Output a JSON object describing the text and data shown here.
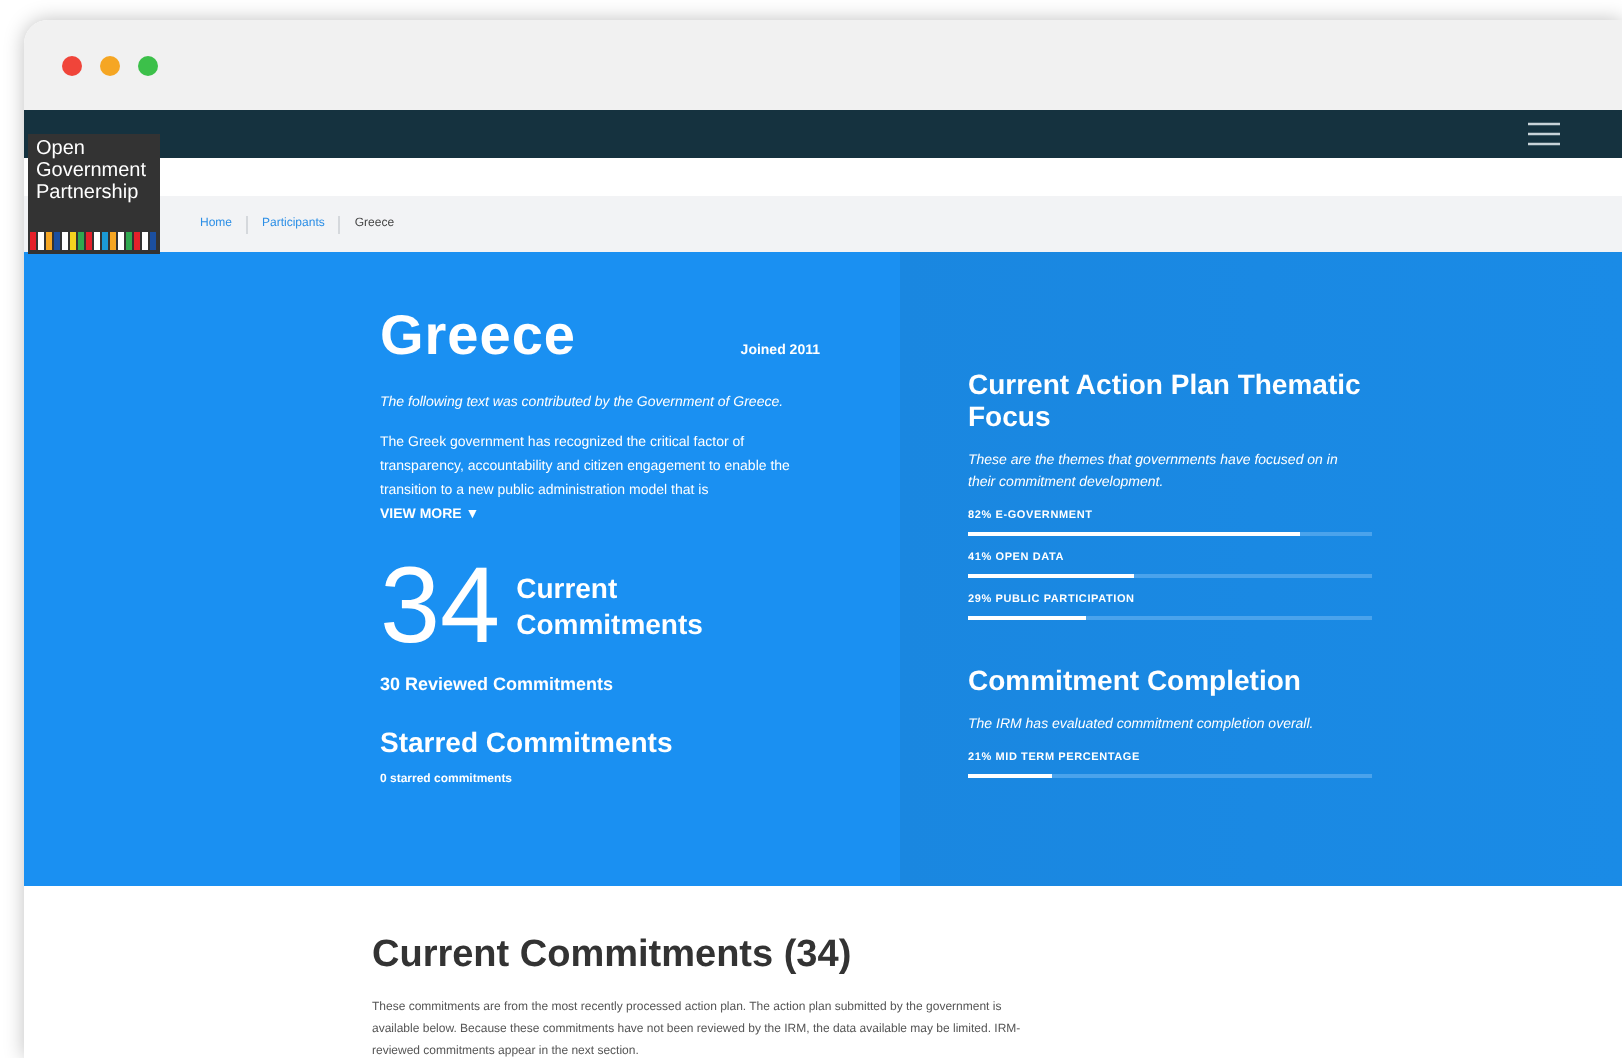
{
  "logo": {
    "lines": [
      "Open",
      "Government",
      "Partnership"
    ]
  },
  "breadcrumb": [
    {
      "label": "Home",
      "current": false
    },
    {
      "label": "Participants",
      "current": false
    },
    {
      "label": "Greece",
      "current": true
    }
  ],
  "country": {
    "name": "Greece",
    "joined": "Joined 2011",
    "intro": "The following text was contributed by the Government of Greece.",
    "body": "The Greek government has recognized the critical factor of transparency, accountability and citizen engagement to enable the transition to a new public administration model that is",
    "view_more": "VIEW MORE",
    "view_more_icon": "▼"
  },
  "commitments": {
    "count": "34",
    "label": "Current Commitments",
    "reviewed": "30 Reviewed Commitments",
    "starred_title": "Starred Commitments",
    "starred": "0 starred commitments"
  },
  "thematic": {
    "title": "Current Action Plan Thematic Focus",
    "subtitle": "These are the themes that governments have focused on in their commitment development.",
    "themes": [
      {
        "label": "82% E-GOVERNMENT",
        "level": 0.82
      },
      {
        "label": "41% OPEN DATA",
        "level": 0.41
      },
      {
        "label": "29% PUBLIC PARTICIPATION",
        "level": 0.29
      }
    ]
  },
  "completion": {
    "title": "Commitment Completion",
    "subtitle": "The IRM has evaluated commitment completion overall.",
    "items": [
      {
        "label": "21% MID TERM PERCENTAGE",
        "level": 0.21
      }
    ]
  },
  "current": {
    "title": "Current Commitments (34)",
    "text": "These commitments are from the most recently processed action plan. The action plan submitted by the government is available below. Because these commitments have not been reviewed by the IRM, the data available may be limited. IRM-reviewed commitments appear in the next section."
  }
}
